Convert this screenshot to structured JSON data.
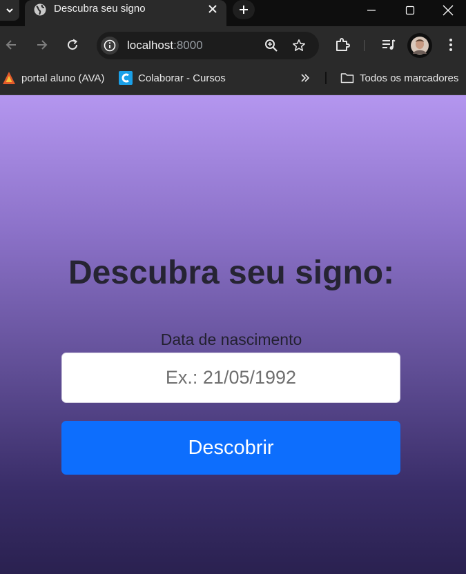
{
  "browser": {
    "tab": {
      "title": "Descubra seu signo"
    },
    "address_bar": {
      "host": "localhost",
      "port": ":8000"
    },
    "bookmarks": [
      {
        "label": "portal aluno (AVA)",
        "icon": "ava-triangle-icon"
      },
      {
        "label": "Colaborar - Cursos",
        "icon": "colaborar-c-icon"
      }
    ],
    "all_bookmarks_label": "Todos os marcadores",
    "colors": {
      "tabstrip": "#0e0e0e",
      "toolbar": "#2a2a2a",
      "omnibox": "#1c1c1c"
    }
  },
  "page": {
    "heading": "Descubra seu signo:",
    "date_field": {
      "label": "Data de nascimento",
      "placeholder": "Ex.: 21/05/1992",
      "value": ""
    },
    "submit_label": "Descobrir",
    "colors": {
      "gradient_top": "#b496ef",
      "gradient_bottom": "#2a2150",
      "button": "#0d6efd",
      "heading_text": "#262433"
    }
  }
}
